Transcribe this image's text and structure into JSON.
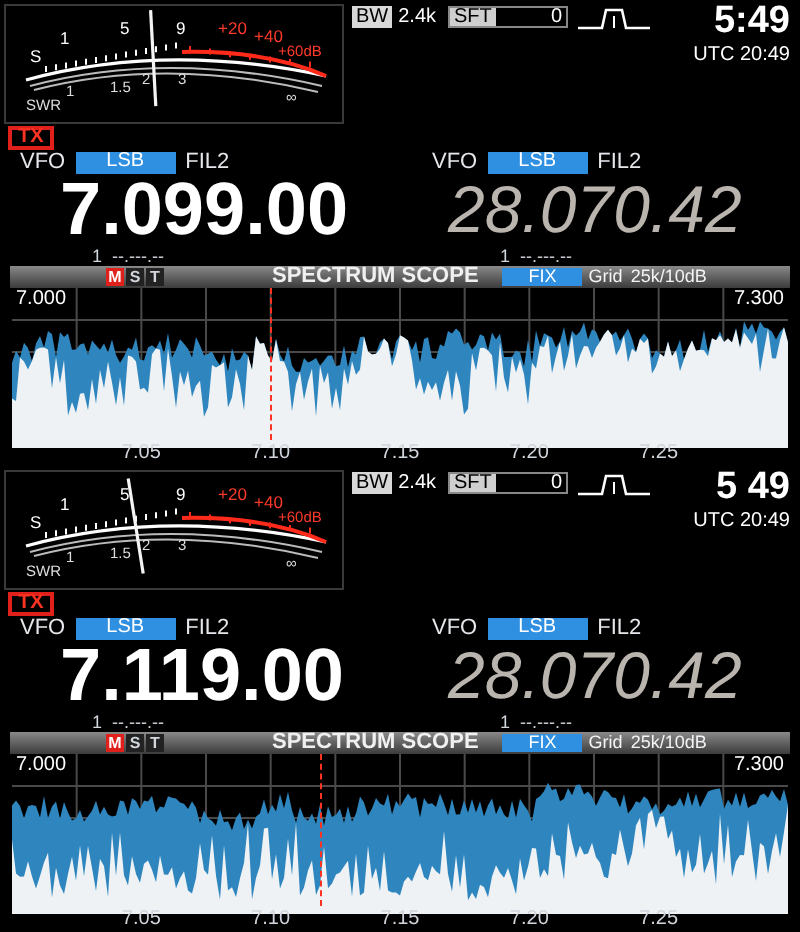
{
  "panels": [
    {
      "meter": {
        "s_scale": [
          "S",
          "1",
          "5",
          "9",
          "+20",
          "+40",
          "+60dB"
        ],
        "swr_scale": [
          "SWR",
          "1",
          "1.5",
          "2",
          "3",
          "∞"
        ],
        "level": 0.47
      },
      "tx_badge": "TX",
      "bw": {
        "label": "BW",
        "value": "2.4k"
      },
      "sft": {
        "label": "SFT",
        "value": "0"
      },
      "time": "5:49",
      "utc": "UTC 20:49",
      "main": {
        "vfo": "VFO",
        "mode": "LSB",
        "filter": "FIL2",
        "frequency": "7.099.00",
        "memo_channel": "1",
        "memo_frequency": "--.---.--"
      },
      "sub": {
        "vfo": "VFO",
        "mode": "LSB",
        "filter": "FIL2",
        "frequency": "28.070.42",
        "memo_channel": "1",
        "memo_frequency": "--.---.--"
      },
      "scope": {
        "title": "SPECTRUM SCOPE",
        "modes": [
          {
            "label": "M",
            "selected": true
          },
          {
            "label": "S",
            "selected": false
          },
          {
            "label": "T",
            "selected": false
          }
        ],
        "fix": "FIX",
        "grid_label": "Grid",
        "grid_value": "25k/10dB",
        "start": "7.000",
        "end": "7.300",
        "ticks": [
          "7.05",
          "7.10",
          "7.15",
          "7.20",
          "7.25"
        ],
        "marker": {
          "level": 0.333
        }
      }
    },
    {
      "meter": {
        "s_scale": [
          "S",
          "1",
          "5",
          "9",
          "+20",
          "+40",
          "+60dB"
        ],
        "swr_scale": [
          "SWR",
          "1",
          "1.5",
          "2",
          "3",
          "∞"
        ],
        "level": 0.41
      },
      "tx_badge": "TX",
      "bw": {
        "label": "BW",
        "value": "2.4k"
      },
      "sft": {
        "label": "SFT",
        "value": "0"
      },
      "time": "5 49",
      "utc": "UTC 20:49",
      "main": {
        "vfo": "VFO",
        "mode": "LSB",
        "filter": "FIL2",
        "frequency": "7.119.00",
        "memo_channel": "1",
        "memo_frequency": "--.---.--"
      },
      "sub": {
        "vfo": "VFO",
        "mode": "LSB",
        "filter": "FIL2",
        "frequency": "28.070.42",
        "memo_channel": "1",
        "memo_frequency": "--.---.--"
      },
      "scope": {
        "title": "SPECTRUM SCOPE",
        "modes": [
          {
            "label": "M",
            "selected": true
          },
          {
            "label": "S",
            "selected": false
          },
          {
            "label": "T",
            "selected": false
          }
        ],
        "fix": "FIX",
        "grid_label": "Grid",
        "grid_value": "25k/10dB",
        "start": "7.000",
        "end": "7.300",
        "ticks": [
          "7.05",
          "7.10",
          "7.15",
          "7.20",
          "7.25"
        ],
        "marker": {
          "level": 0.397
        }
      }
    }
  ]
}
